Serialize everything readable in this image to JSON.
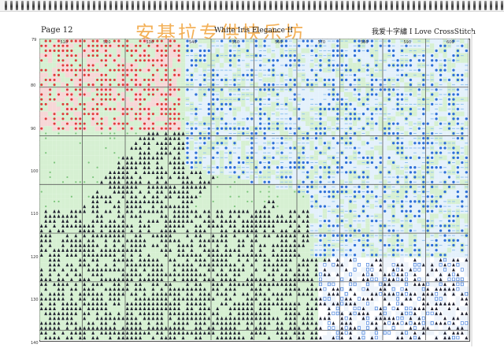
{
  "header": {
    "page_label": "Page 12",
    "watermark_text": "安基拉专供快乐坊",
    "pattern_title": "White Iris Elegance II",
    "brand": "我爱十字繡 I Love CrossStitch"
  },
  "grid": {
    "column_numbers": [
      "510",
      "520",
      "530",
      "540",
      "550",
      "560",
      "570",
      "580",
      "590",
      "600"
    ],
    "row_numbers": [
      "80",
      "90",
      "100",
      "110",
      "120",
      "130",
      "140"
    ],
    "corner_label": "79"
  },
  "colors": {
    "pale_green": "#d6f0d2",
    "light_green": "#c4e8bf",
    "red_symbol": "#e03a3a",
    "pink_bg": "#f7d7d7",
    "dark_symbol": "#1e1e2e",
    "blue_symbol": "#2d6fd8",
    "light_blue": "#8fc1f0",
    "grid_major": "#5a5a5a",
    "watermark": "#f2a33a"
  }
}
